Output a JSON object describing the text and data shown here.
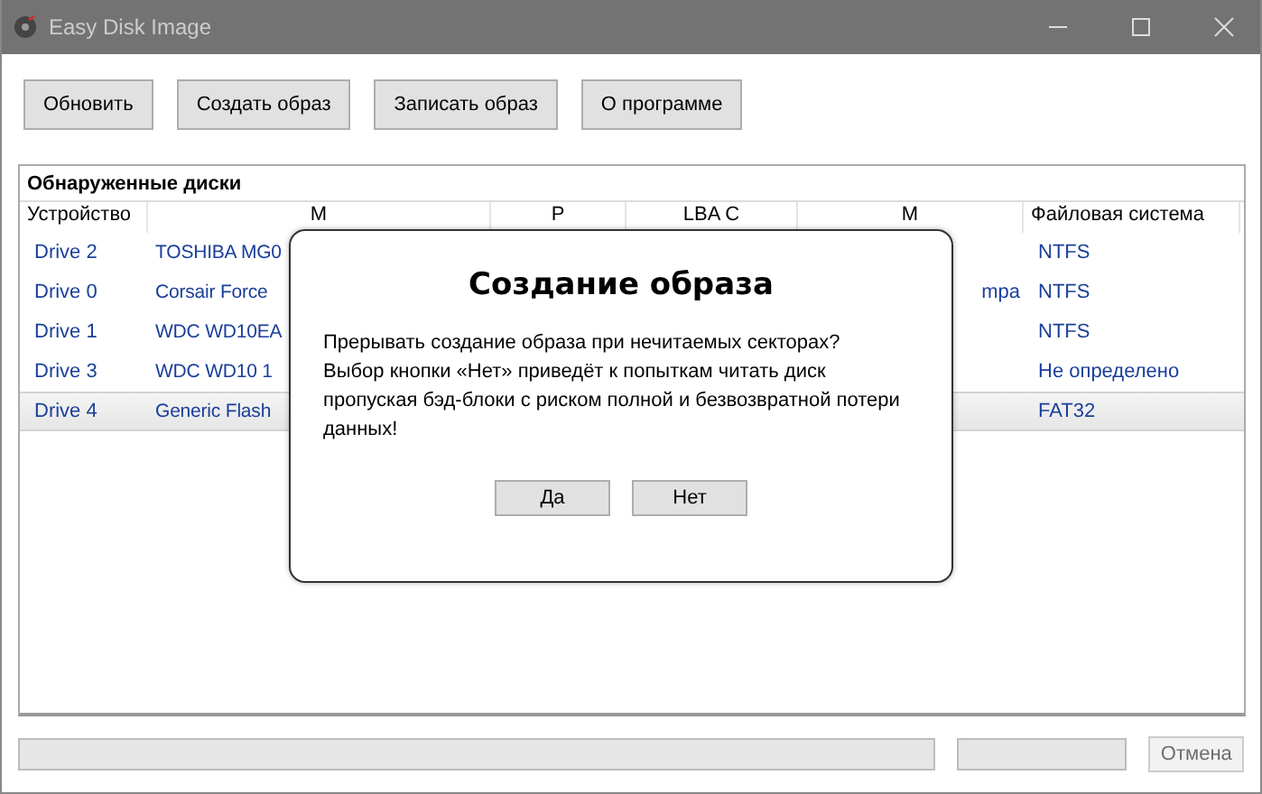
{
  "window": {
    "title": "Easy Disk Image"
  },
  "toolbar": [
    "Обновить",
    "Создать образ",
    "Записать образ",
    "О программе"
  ],
  "group_title": "Обнаруженные диски",
  "columns": [
    "Устройство",
    "М",
    "Р",
    "LBA С",
    "М",
    "Файловая система"
  ],
  "rows": [
    {
      "device": "Drive 2",
      "model": "TOSHIBA MG0",
      "column_5": "",
      "fs": "NTFS",
      "selected": false
    },
    {
      "device": "Drive 0",
      "model": "Corsair Force",
      "column_5": "mpa",
      "fs": "NTFS",
      "selected": false
    },
    {
      "device": "Drive 1",
      "model": "WDC WD10EA",
      "column_5": "",
      "fs": "NTFS",
      "selected": false
    },
    {
      "device": "Drive 3",
      "model": "WDC WD10 1",
      "column_5": "",
      "fs": "Не определено",
      "selected": false
    },
    {
      "device": "Drive 4",
      "model": "Generic Flash",
      "column_5": "",
      "fs": "FAT32",
      "selected": true
    }
  ],
  "dialog": {
    "title": "Создание образа",
    "message": "Прерывать создание образа при нечитаемых секторах?\nВыбор кнопки «Нет» приведёт к попыткам читать диск\nпропуская бэд-блоки с риском полной и безвозвратной потери\nданных!",
    "buttons": [
      "Да",
      "Нет"
    ]
  },
  "progress": {
    "level": 0
  },
  "cancel_button": {
    "label": "Отмена",
    "disabled": true
  }
}
